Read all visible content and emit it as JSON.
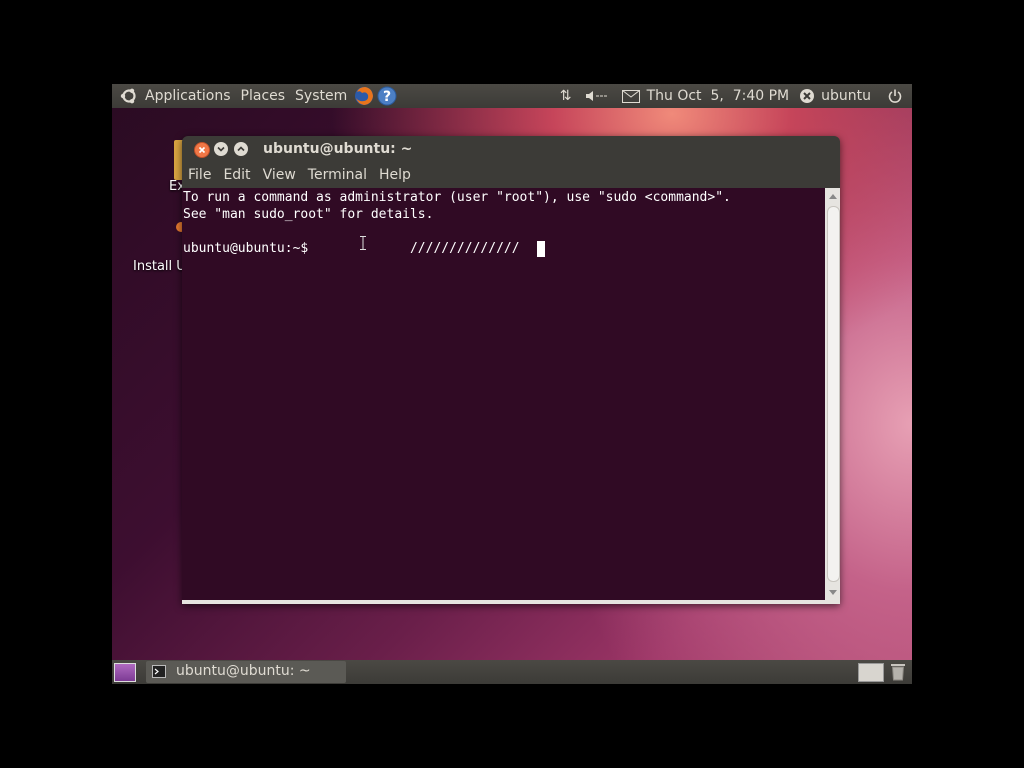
{
  "top_panel": {
    "menus": [
      "Applications",
      "Places",
      "System"
    ],
    "clock": "Thu Oct  5,  7:40 PM",
    "user": "ubuntu"
  },
  "desktop": {
    "icon1_label": "Ex",
    "icon2_label": "Install U"
  },
  "terminal": {
    "title": "ubuntu@ubuntu: ~",
    "menus": [
      "File",
      "Edit",
      "View",
      "Terminal",
      "Help"
    ],
    "lines": [
      "To run a command as administrator (user \"root\"), use \"sudo <command>\".",
      "See \"man sudo_root\" for details.",
      "",
      "ubuntu@ubuntu:~$             ////////////// "
    ]
  },
  "bottom_panel": {
    "task_label": "ubuntu@ubuntu: ~"
  },
  "colors": {
    "panel": "#3c3b37",
    "terminal_bg": "#300a24",
    "close_button": "#f07746"
  }
}
